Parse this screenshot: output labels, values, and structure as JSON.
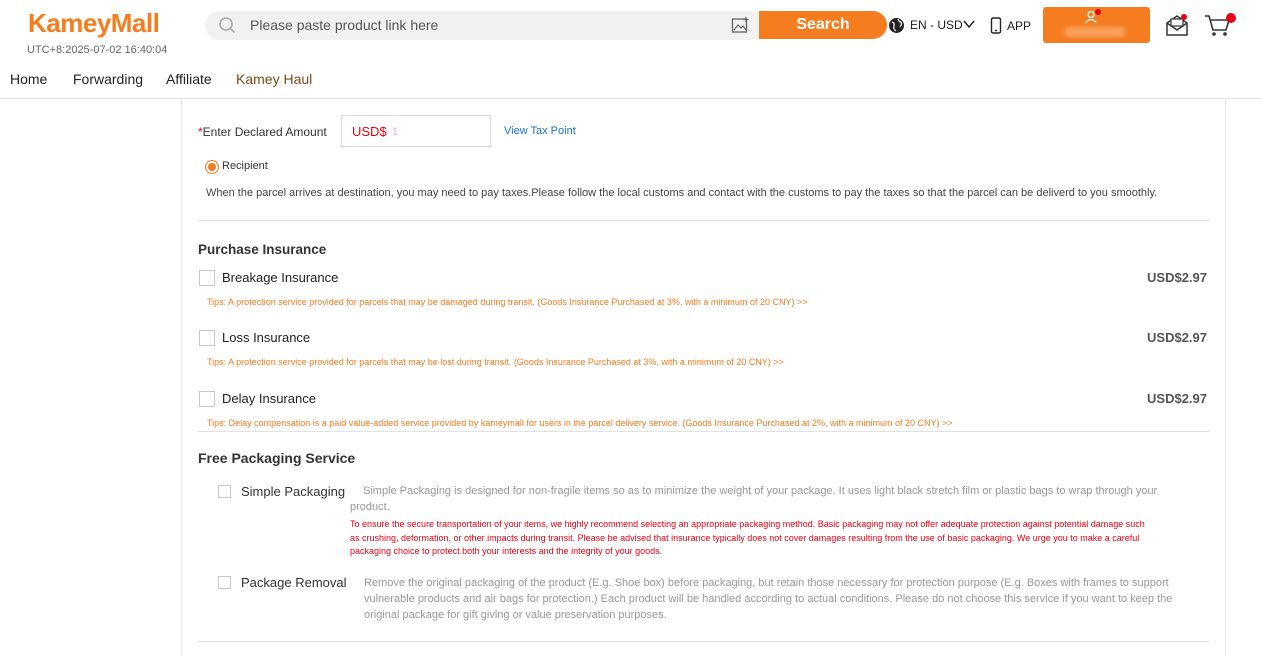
{
  "header": {
    "logo": "KameyMall",
    "clock": "UTC+8:2025-07-02 16:40:04",
    "search_placeholder": "Please paste product link here",
    "search_button": "Search",
    "language": "EN - USD",
    "app_label": "APP"
  },
  "nav": {
    "items": [
      "Home",
      "Forwarding",
      "Affiliate",
      "Kamey Haul"
    ]
  },
  "declared": {
    "required_mark": "*",
    "label": "Enter Declared Amount",
    "currency": "USD$",
    "value": "1",
    "link": "View Tax Point",
    "radio_label": "Recipient",
    "info": "When the parcel arrives at destination, you may need to pay taxes.Please follow the local customs and contact with the customs to pay the taxes so that the parcel can be deliverd to you smoothly."
  },
  "insurance": {
    "title": "Purchase Insurance",
    "items": [
      {
        "name": "Breakage Insurance",
        "price": "USD$2.97",
        "tip": "Tips: A protection service provided for parcels that may be damaged during transit. (Goods Insurance Purchased at 3%, with a minimum of 20 CNY)  >>"
      },
      {
        "name": "Loss Insurance",
        "price": "USD$2.97",
        "tip": "Tips: A protection service provided for parcels that may be lost during transit. (Goods Insurance Purchased at 3%, with a minimum of 20 CNY)  >>"
      },
      {
        "name": "Delay Insurance",
        "price": "USD$2.97",
        "tip": "Tips: Delay compensation is a paid value-added service provided by kameymall for users in the parcel delivery service. (Goods Insurance Purchased at 2%, with a minimum of 20 CNY)  >>"
      }
    ]
  },
  "packaging": {
    "title": "Free Packaging Service",
    "simple": {
      "name": "Simple Packaging",
      "desc_line1": "Simple Packaging is designed for non-fragile items so as to minimize the weight of your package. It uses light black stretch film or plastic bags to wrap through your",
      "desc_line2": "product.",
      "warn_line1": "To ensure the secure transportation of your items, we highly recommend selecting an appropriate packaging method. Basic packaging may not offer adequate protection against potential damage such",
      "warn_line2": "as crushing, deformation, or other impacts during transit. Please be advised that insurance typically does not cover damages resulting from the use of basic packaging. We urge you to make a careful",
      "warn_line3": "packaging choice to protect both your interests and the integrity of your goods."
    },
    "removal": {
      "name": "Package Removal",
      "desc_line1": "Remove the original packaging of the product (E.g. Shoe box) before packaging, but retain those necessary for protection purpose (E.g. Boxes with frames to support",
      "desc_line2": "vulnerable products and air bags for protection.) Each product will be handled according to actual conditions. Please do not choose this service if you want to keep the",
      "desc_line3": "original package for gift giving or value preservation purposes."
    }
  },
  "colors": {
    "brand": "#f57c1f",
    "alert": "#e60012",
    "link": "#1a73c8"
  }
}
